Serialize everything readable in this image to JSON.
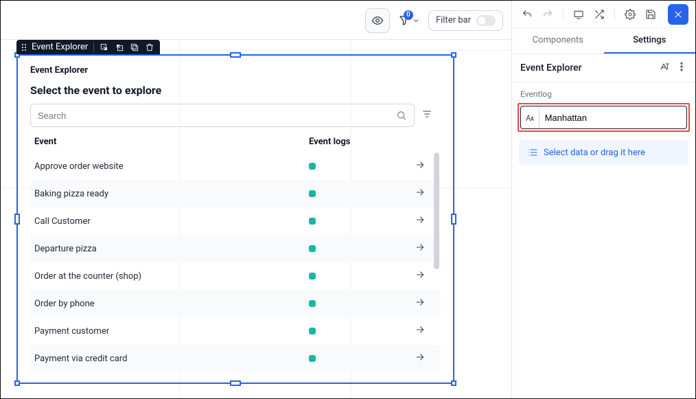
{
  "topbar": {
    "filter_bar_label": "Filter bar",
    "filter_badge": "0"
  },
  "selection_toolbar": {
    "title": "Event Explorer"
  },
  "widget": {
    "title": "Event Explorer",
    "subtitle": "Select the event to explore",
    "search_placeholder": "Search",
    "columns": {
      "event": "Event",
      "logs": "Event logs"
    },
    "rows": [
      {
        "name": "Approve order website"
      },
      {
        "name": "Baking pizza ready"
      },
      {
        "name": "Call Customer"
      },
      {
        "name": "Departure pizza"
      },
      {
        "name": "Order at the counter (shop)"
      },
      {
        "name": "Order by phone"
      },
      {
        "name": "Payment customer"
      },
      {
        "name": "Payment via credit card"
      }
    ]
  },
  "sidebar": {
    "tabs": {
      "components": "Components",
      "settings": "Settings"
    },
    "header_title": "Event Explorer",
    "section_label": "Eventlog",
    "field_value": "Manhattan",
    "dropzone_text": "Select data or drag it here"
  }
}
